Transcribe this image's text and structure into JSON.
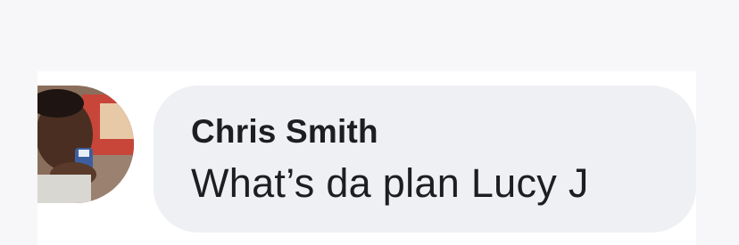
{
  "comment": {
    "author": "Chris Smith",
    "text": "What’s da plan Lucy J",
    "avatar": "user-avatar-photo"
  },
  "colors": {
    "background": "#f7f7fa",
    "bubble": "#eff0f3",
    "text": "#1c1e21"
  }
}
